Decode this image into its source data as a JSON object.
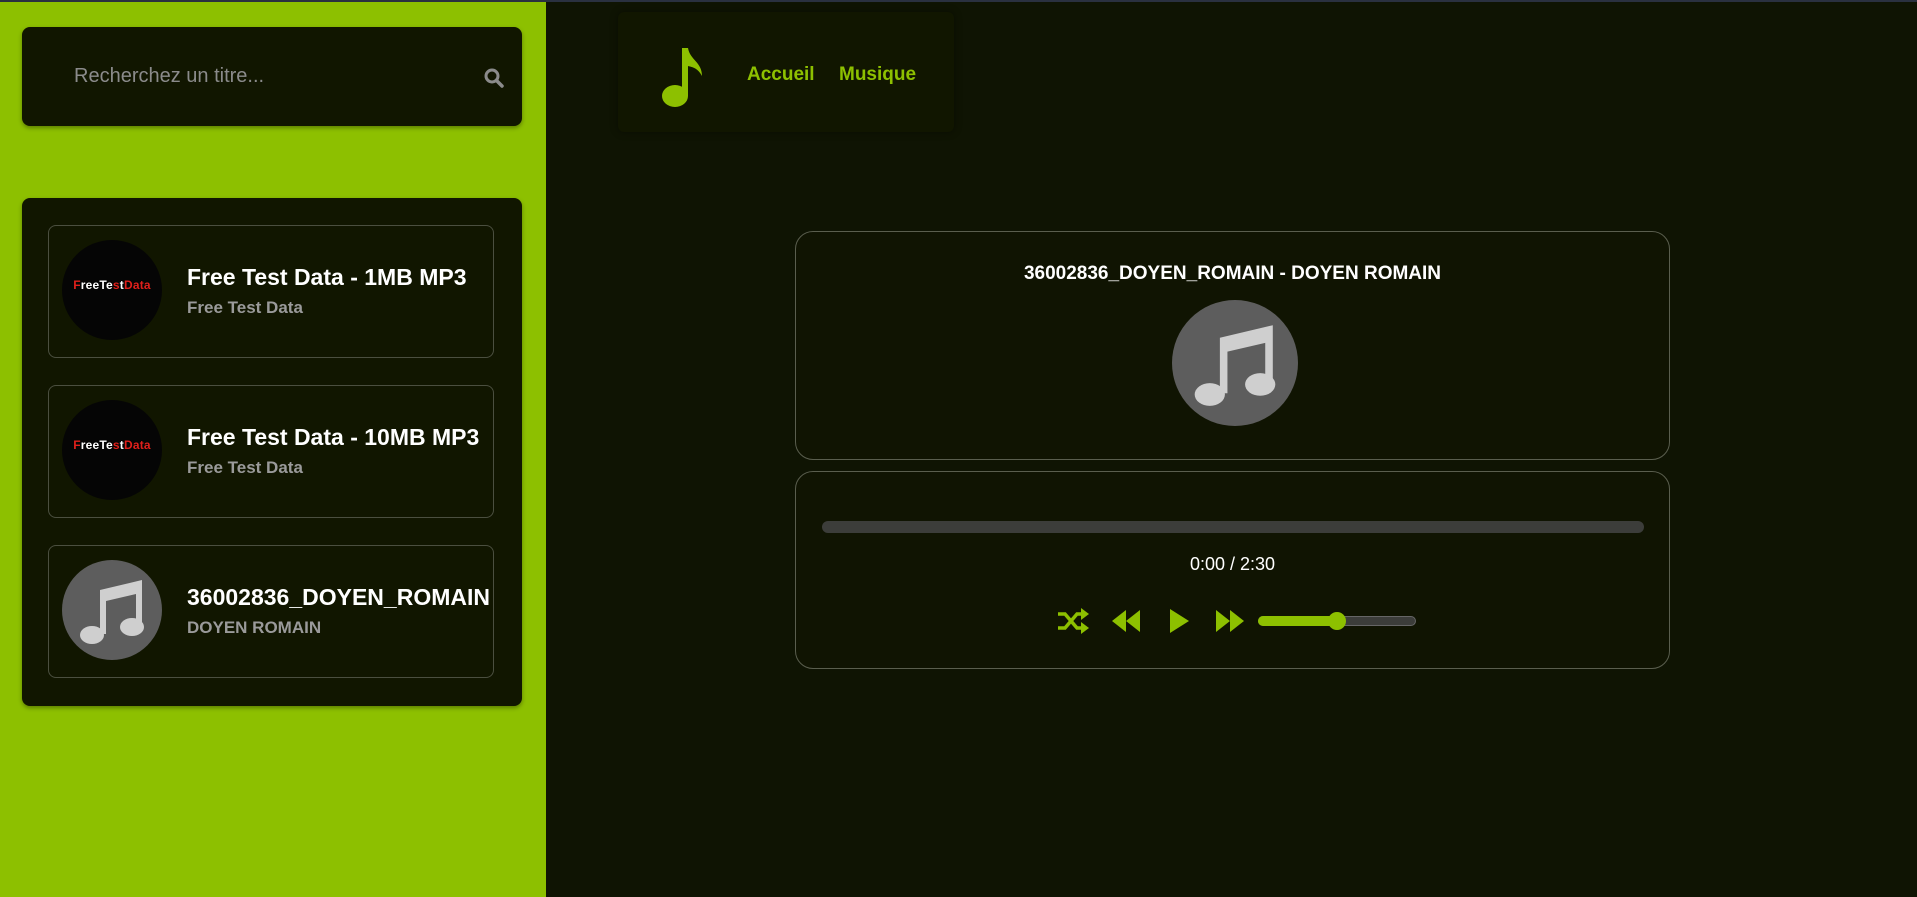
{
  "search": {
    "placeholder": "Recherchez un titre..."
  },
  "nav": {
    "links": [
      "Accueil",
      "Musique"
    ]
  },
  "playlist": [
    {
      "title": "Free Test Data - 1MB MP3",
      "artist": "Free Test Data",
      "cover": "freetestdata-logo",
      "logo_text": "FreeTestData"
    },
    {
      "title": "Free Test Data - 10MB MP3",
      "artist": "Free Test Data",
      "cover": "freetestdata-logo",
      "logo_text": "FreeTestData"
    },
    {
      "title": "36002836_DOYEN_ROMAIN",
      "artist": "DOYEN ROMAIN",
      "cover": "music-note-icon"
    }
  ],
  "player": {
    "now_playing": "36002836_DOYEN_ROMAIN - DOYEN ROMAIN",
    "time": "0:00 / 2:30",
    "progress": 0,
    "volume": 0.5,
    "controls": [
      "shuffle-icon",
      "rewind-icon",
      "play-icon",
      "fast-forward-icon"
    ]
  },
  "colors": {
    "accent": "#8dc000",
    "background": "#0f1403",
    "panel": "#111600",
    "logo_red": "#e0201b"
  }
}
